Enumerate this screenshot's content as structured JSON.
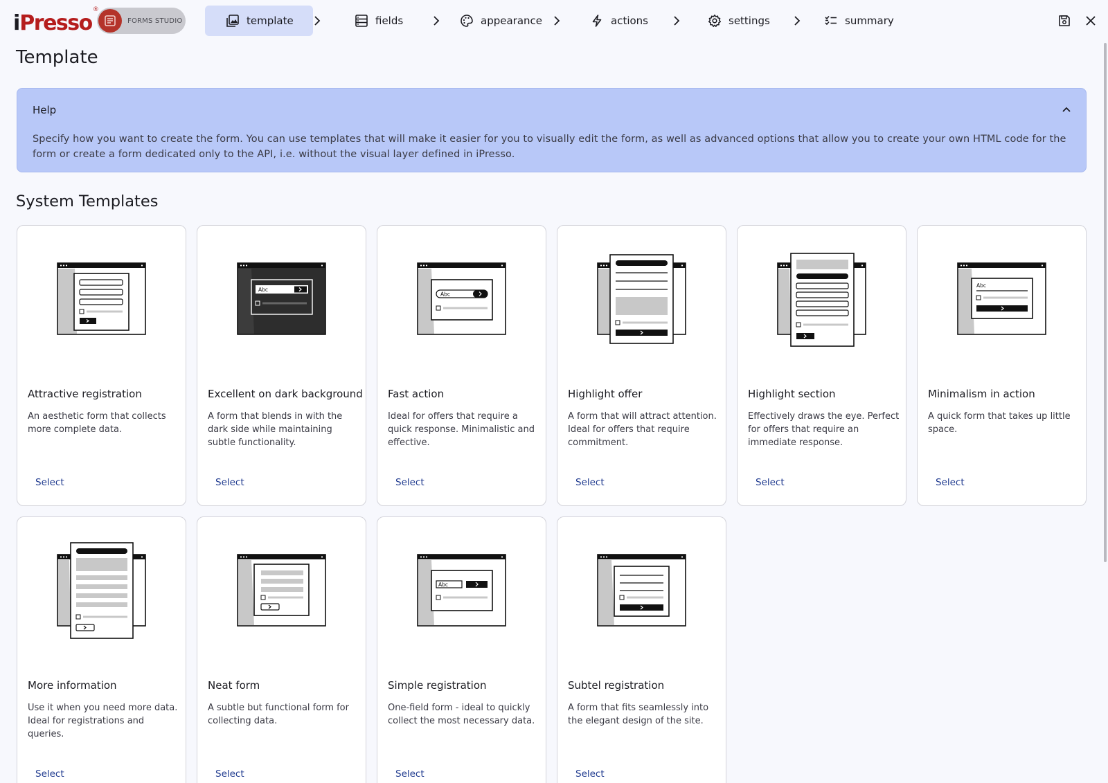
{
  "brand": {
    "logo_i": "i",
    "logo_rest": "Presso",
    "logo_reg": "®",
    "studio_label": "FORMS STUDIO"
  },
  "steps": [
    {
      "label": "template",
      "icon": "image-template-icon",
      "active": true
    },
    {
      "label": "fields",
      "icon": "fields-list-icon",
      "active": false
    },
    {
      "label": "appearance",
      "icon": "palette-icon",
      "active": false
    },
    {
      "label": "actions",
      "icon": "lightning-icon",
      "active": false
    },
    {
      "label": "settings",
      "icon": "gear-icon",
      "active": false
    },
    {
      "label": "summary",
      "icon": "checklist-icon",
      "active": false
    }
  ],
  "toolbar": {
    "save_icon": "save-icon",
    "close_icon": "close-icon"
  },
  "page": {
    "title": "Template"
  },
  "help": {
    "title": "Help",
    "text": "Specify how you want to create the form. You can use templates that will make it easier for you to visually edit the form, as well as advanced options that allow you to create your own HTML code for the form or create a form dedicated only to the API, i.e. without the visual layer defined in iPresso."
  },
  "section": {
    "title": "System Templates"
  },
  "colors": {
    "accent_bg": "#d5ddf9",
    "help_bg": "#b8c8f8",
    "brand_red": "#b51d1d",
    "link": "#1f3a8f"
  },
  "templates": [
    {
      "name": "Attractive registration",
      "desc": "An aesthetic form that collects more complete data.",
      "select": "Select"
    },
    {
      "name": "Excellent on dark background",
      "desc": "A form that blends in with the dark side while maintaining subtle functionality.",
      "select": "Select",
      "illus_text": "Abc"
    },
    {
      "name": "Fast action",
      "desc": "Ideal for offers that require a quick response. Minimalistic and effective.",
      "select": "Select",
      "illus_text": "Abc"
    },
    {
      "name": "Highlight offer",
      "desc": "A form that will attract attention. Ideal for offers that require commitment.",
      "select": "Select"
    },
    {
      "name": "Highlight section",
      "desc": "Effectively draws the eye. Perfect for offers that require an immediate response.",
      "select": "Select"
    },
    {
      "name": "Minimalism in action",
      "desc": "A quick form that takes up little space.",
      "select": "Select",
      "illus_text": "Abc"
    },
    {
      "name": "More information",
      "desc": "Use it when you need more data. Ideal for registrations and queries.",
      "select": "Select"
    },
    {
      "name": "Neat form",
      "desc": "A subtle but functional form for collecting data.",
      "select": "Select"
    },
    {
      "name": "Simple registration",
      "desc": "One-field form - ideal to quickly collect the most necessary data.",
      "select": "Select",
      "illus_text": "Abc"
    },
    {
      "name": "Subtel registration",
      "desc": "A form that fits seamlessly into the elegant design of the site.",
      "select": "Select"
    }
  ]
}
